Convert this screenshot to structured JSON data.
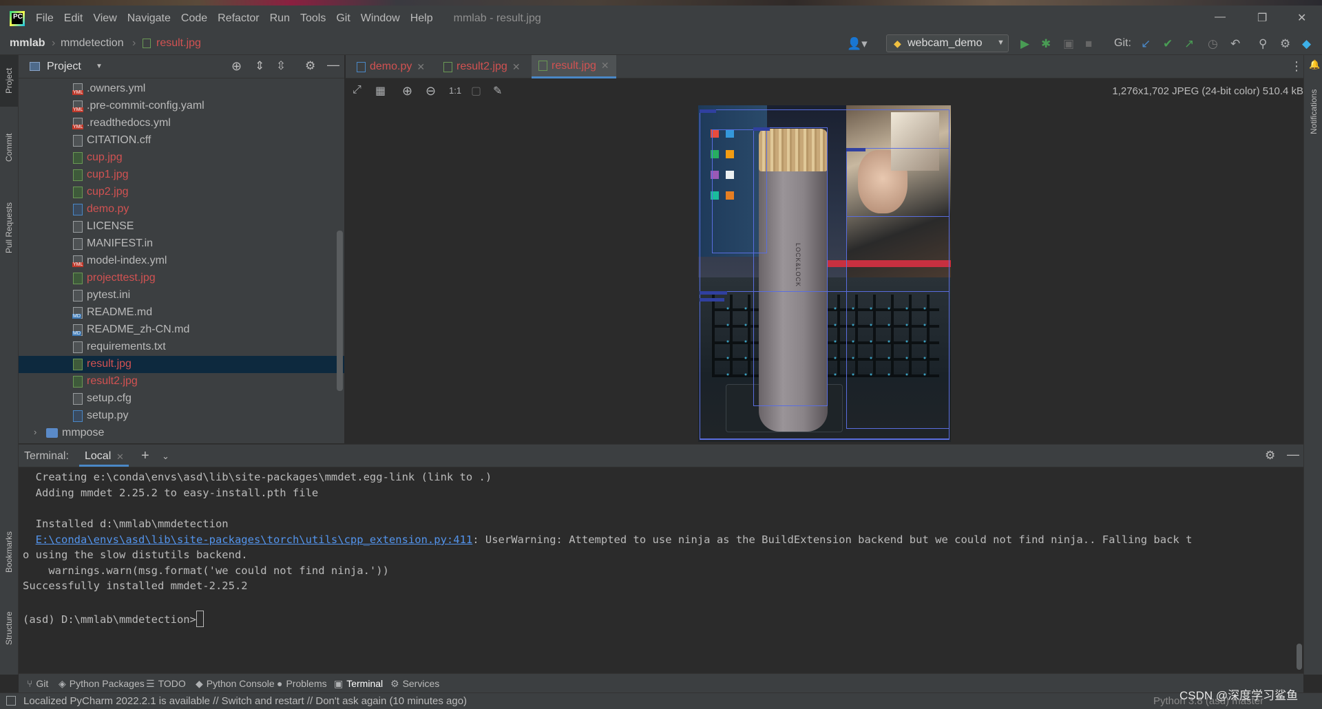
{
  "window": {
    "title": "mmlab - result.jpg",
    "menu": [
      "File",
      "Edit",
      "View",
      "Navigate",
      "Code",
      "Refactor",
      "Run",
      "Tools",
      "Git",
      "Window",
      "Help"
    ],
    "minimize": "—",
    "restore": "❐",
    "close": "✕"
  },
  "navbar": {
    "breadcrumbs": [
      "mmlab",
      "mmdetection",
      "result.jpg"
    ],
    "run_config": "webcam_demo",
    "git_label": "Git:"
  },
  "left_strip": [
    "Project",
    "Commit",
    "Pull Requests",
    "Bookmarks",
    "Structure"
  ],
  "right_strip": [
    "Notifications"
  ],
  "project": {
    "header": "Project",
    "files": [
      {
        "name": ".owners.yml",
        "type": "yml",
        "color": "normal"
      },
      {
        "name": ".pre-commit-config.yaml",
        "type": "yml",
        "color": "normal"
      },
      {
        "name": ".readthedocs.yml",
        "type": "yml",
        "color": "normal"
      },
      {
        "name": "CITATION.cff",
        "type": "file",
        "color": "normal"
      },
      {
        "name": "cup.jpg",
        "type": "img",
        "color": "red"
      },
      {
        "name": "cup1.jpg",
        "type": "img",
        "color": "red"
      },
      {
        "name": "cup2.jpg",
        "type": "img",
        "color": "red"
      },
      {
        "name": "demo.py",
        "type": "py",
        "color": "red"
      },
      {
        "name": "LICENSE",
        "type": "file",
        "color": "normal"
      },
      {
        "name": "MANIFEST.in",
        "type": "file",
        "color": "normal"
      },
      {
        "name": "model-index.yml",
        "type": "yml",
        "color": "normal"
      },
      {
        "name": "projecttest.jpg",
        "type": "img",
        "color": "red"
      },
      {
        "name": "pytest.ini",
        "type": "file",
        "color": "normal"
      },
      {
        "name": "README.md",
        "type": "md",
        "color": "normal"
      },
      {
        "name": "README_zh-CN.md",
        "type": "md",
        "color": "normal"
      },
      {
        "name": "requirements.txt",
        "type": "file",
        "color": "normal"
      },
      {
        "name": "result.jpg",
        "type": "img",
        "color": "red",
        "selected": true
      },
      {
        "name": "result2.jpg",
        "type": "img",
        "color": "red"
      },
      {
        "name": "setup.cfg",
        "type": "file",
        "color": "normal"
      },
      {
        "name": "setup.py",
        "type": "py",
        "color": "normal"
      }
    ],
    "folder": "mmpose"
  },
  "editor": {
    "tabs": [
      {
        "label": "demo.py",
        "active": false
      },
      {
        "label": "result2.jpg",
        "active": false
      },
      {
        "label": "result.jpg",
        "active": true
      }
    ],
    "zoom_actual": "1:1",
    "image_info": "1,276x1,702 JPEG (24-bit color) 510.4 kB",
    "bottle_text": "LOCK&LOCK"
  },
  "terminal": {
    "label": "Terminal:",
    "tab": "Local",
    "lines": [
      {
        "text": "  Creating e:\\conda\\envs\\asd\\lib\\site-packages\\mmdet.egg-link (link to .)"
      },
      {
        "text": "  Adding mmdet 2.25.2 to easy-install.pth file"
      },
      {
        "text": ""
      },
      {
        "text": "  Installed d:\\mmlab\\mmdetection"
      },
      {
        "link": "E:\\conda\\envs\\asd\\lib\\site-packages\\torch\\utils\\cpp_extension.py:411",
        "text": ": UserWarning: Attempted to use ninja as the BuildExtension backend but we could not find ninja.. Falling back t"
      },
      {
        "text": "o using the slow distutils backend."
      },
      {
        "text": "    warnings.warn(msg.format('we could not find ninja.'))"
      },
      {
        "text": "Successfully installed mmdet-2.25.2"
      },
      {
        "text": ""
      },
      {
        "text": "(asd) D:\\mmlab\\mmdetection>"
      }
    ]
  },
  "bottom_tabs": [
    {
      "label": "Git",
      "icon": "git-branch-icon"
    },
    {
      "label": "Python Packages",
      "icon": "packages-icon"
    },
    {
      "label": "TODO",
      "icon": "todo-list-icon"
    },
    {
      "label": "Python Console",
      "icon": "python-console-icon"
    },
    {
      "label": "Problems",
      "icon": "problems-icon"
    },
    {
      "label": "Terminal",
      "icon": "terminal-icon",
      "active": true
    },
    {
      "label": "Services",
      "icon": "services-icon"
    }
  ],
  "status": {
    "message": "Localized PyCharm 2022.2.1 is available // Switch and restart // Don't ask again (10 minutes ago)",
    "right": "Python 3.8 (asd)     master",
    "watermark": "CSDN @深度学习鲨鱼"
  },
  "colors": {
    "vcs_modified": "#d25252",
    "selection": "#0d293e",
    "accent": "#4a88c7",
    "link": "#5394ec"
  }
}
